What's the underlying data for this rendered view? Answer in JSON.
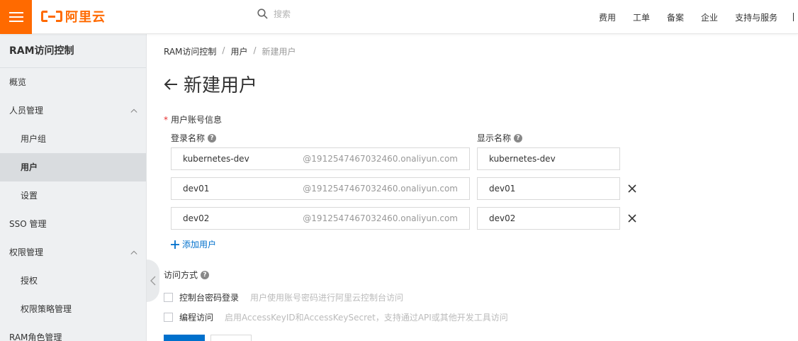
{
  "brand": {
    "name": "阿里云",
    "accent": "#ff6a00",
    "link_color": "#0070cc"
  },
  "search": {
    "placeholder": "搜索"
  },
  "topnav": [
    "费用",
    "工单",
    "备案",
    "企业",
    "支持与服务"
  ],
  "sidebar": {
    "title": "RAM访问控制",
    "items": [
      {
        "label": "概览"
      },
      {
        "label": "人员管理"
      },
      {
        "label": "用户组"
      },
      {
        "label": "用户"
      },
      {
        "label": "设置"
      },
      {
        "label": "SSO 管理"
      },
      {
        "label": "权限管理"
      },
      {
        "label": "授权"
      },
      {
        "label": "权限策略管理"
      },
      {
        "label": "RAM角色管理"
      }
    ]
  },
  "breadcrumb": {
    "root": "RAM访问控制",
    "parent": "用户",
    "current": "新建用户",
    "sep": "/"
  },
  "page": {
    "title": "新建用户"
  },
  "form": {
    "section_label": "用户账号信息",
    "required_mark": "*",
    "login_name_label": "登录名称",
    "display_name_label": "显示名称",
    "help_glyph": "?",
    "domain_suffix": "@1912547467032460.onaliyun.com",
    "users": [
      {
        "login": "kubernetes-dev",
        "display": "kubernetes-dev"
      },
      {
        "login": "dev01",
        "display": "dev01"
      },
      {
        "login": "dev02",
        "display": "dev02"
      }
    ],
    "add_user_label": "添加用户",
    "access_label": "访问方式",
    "console_login_label": "控制台密码登录",
    "console_login_desc": "用户使用账号密码进行阿里云控制台访问",
    "programmatic_label": "编程访问",
    "programmatic_desc": "启用AccessKeyID和AccessKeySecret，支持通过API或其他开发工具访问"
  }
}
